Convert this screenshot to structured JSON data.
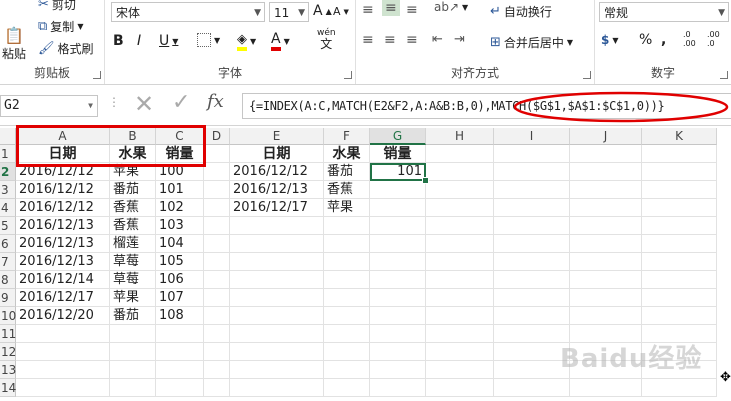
{
  "clipboard": {
    "cut": "剪切",
    "copy": "复制",
    "painter": "格式刷",
    "paste": "粘贴",
    "label": "剪贴板"
  },
  "font": {
    "name": "宋体",
    "size": "11",
    "label": "字体",
    "bold": "B",
    "italic": "I",
    "underline": "U",
    "grow": "A",
    "shrink": "A",
    "font_color": "A",
    "wen": "wén",
    "wen_char": "文"
  },
  "alignment": {
    "label": "对齐方式",
    "wrap": "自动换行",
    "merge": "合并后居中"
  },
  "number": {
    "format": "常规",
    "label": "数字",
    "currency": "$",
    "percent": "%",
    "comma": ",",
    "inc": ".0 .00",
    "dec": ".00 .0"
  },
  "formula_bar": {
    "namebox": "G2",
    "fx": "fx",
    "formula": "{=INDEX(A:C,MATCH(E2&F2,A:A&B:B,0),MATCH($G$1,$A$1:$C$1,0))}"
  },
  "columns": [
    "A",
    "B",
    "C",
    "D",
    "E",
    "F",
    "G",
    "H",
    "I",
    "J",
    "K"
  ],
  "rows": [
    "1",
    "2",
    "3",
    "4",
    "5",
    "6",
    "7",
    "8",
    "9",
    "10",
    "11",
    "12",
    "13",
    "14"
  ],
  "table1": {
    "headers": [
      "日期",
      "水果",
      "销量"
    ],
    "rows": [
      [
        "2016/12/12",
        "苹果",
        "100"
      ],
      [
        "2016/12/12",
        "番茄",
        "101"
      ],
      [
        "2016/12/12",
        "香蕉",
        "102"
      ],
      [
        "2016/12/13",
        "香蕉",
        "103"
      ],
      [
        "2016/12/13",
        "榴莲",
        "104"
      ],
      [
        "2016/12/13",
        "草莓",
        "105"
      ],
      [
        "2016/12/14",
        "草莓",
        "106"
      ],
      [
        "2016/12/17",
        "苹果",
        "107"
      ],
      [
        "2016/12/20",
        "番茄",
        "108"
      ]
    ]
  },
  "table2": {
    "headers": [
      "日期",
      "水果",
      "销量"
    ],
    "rows": [
      [
        "2016/12/12",
        "番茄",
        "101"
      ],
      [
        "2016/12/13",
        "香蕉",
        ""
      ],
      [
        "2016/12/17",
        "苹果",
        ""
      ]
    ]
  },
  "watermark": "Baidu经验"
}
